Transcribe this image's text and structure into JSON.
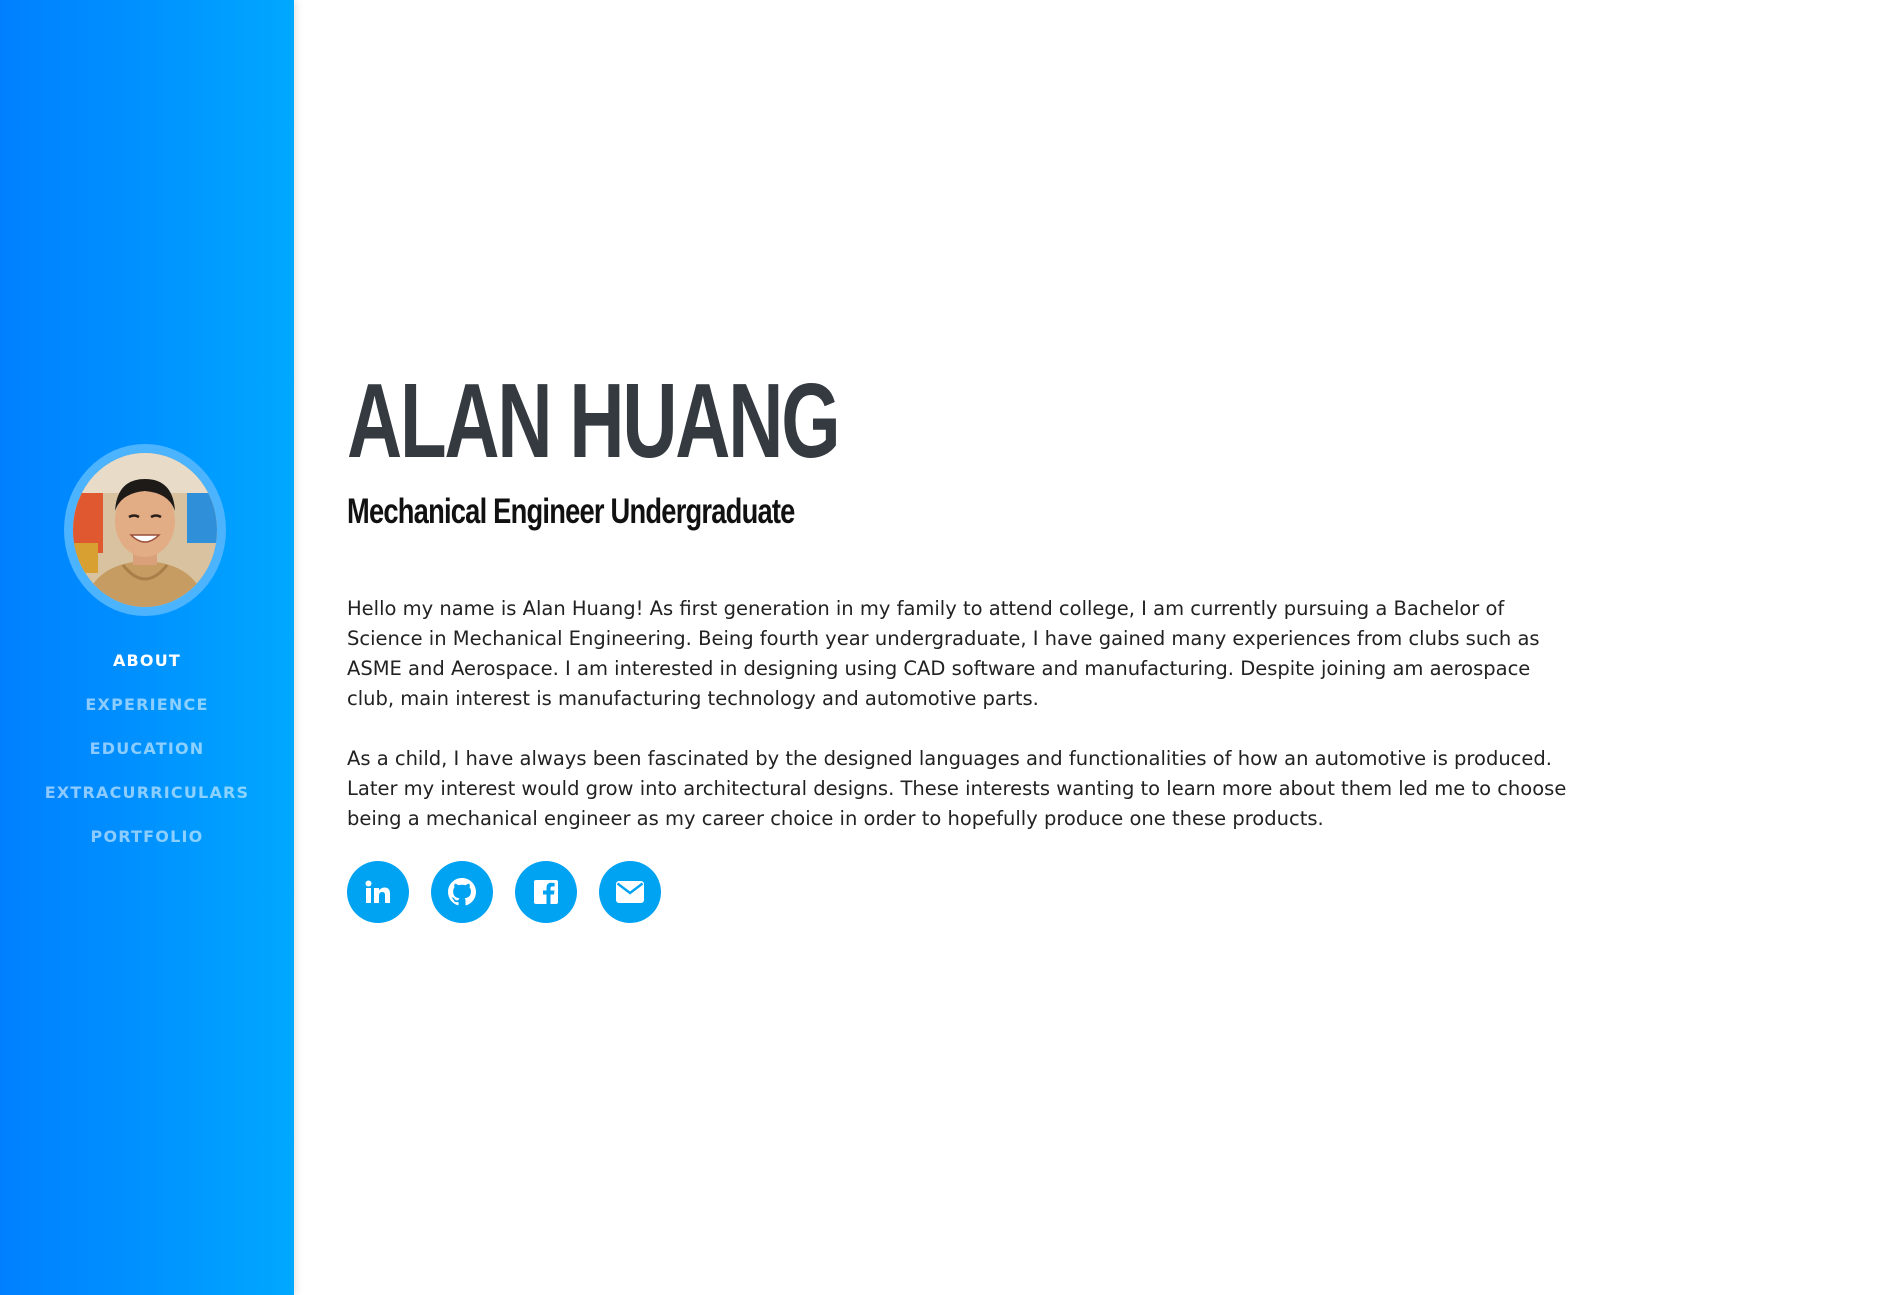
{
  "sidebar": {
    "avatar_alt": "Profile photo",
    "nav_items": [
      {
        "label": "ABOUT",
        "active": true
      },
      {
        "label": "EXPERIENCE",
        "active": false
      },
      {
        "label": "EDUCATION",
        "active": false
      },
      {
        "label": "EXTRACURRICULARS",
        "active": false
      },
      {
        "label": "PORTFOLIO",
        "active": false
      }
    ],
    "gradient_colors": [
      "#0080ff",
      "#00a8ff"
    ]
  },
  "main": {
    "name": "ALAN HUANG",
    "subtitle": "Mechanical Engineer Undergraduate",
    "bio_paragraphs": [
      "Hello my name is Alan Huang! As first generation in my family to attend college, I am currently pursuing a Bachelor of Science in Mechanical Engineering. Being fourth year undergraduate, I have gained many experiences from clubs such as ASME and Aerospace. I am interested in designing using CAD software and manufacturing. Despite joining am aerospace club, main interest is manufacturing technology and automotive parts.",
      "As a child, I have always been fascinated by the designed languages and functionalities of how an automotive is produced. Later my interest would grow into architectural designs. These interests wanting to learn more about them led me to choose being a mechanical engineer as my career choice in order to hopefully produce one these products."
    ],
    "social_links": [
      {
        "icon": "linkedin-icon"
      },
      {
        "icon": "github-icon"
      },
      {
        "icon": "facebook-icon"
      },
      {
        "icon": "email-icon"
      }
    ],
    "accent_color": "#00a2f2",
    "name_color": "#343a40"
  }
}
